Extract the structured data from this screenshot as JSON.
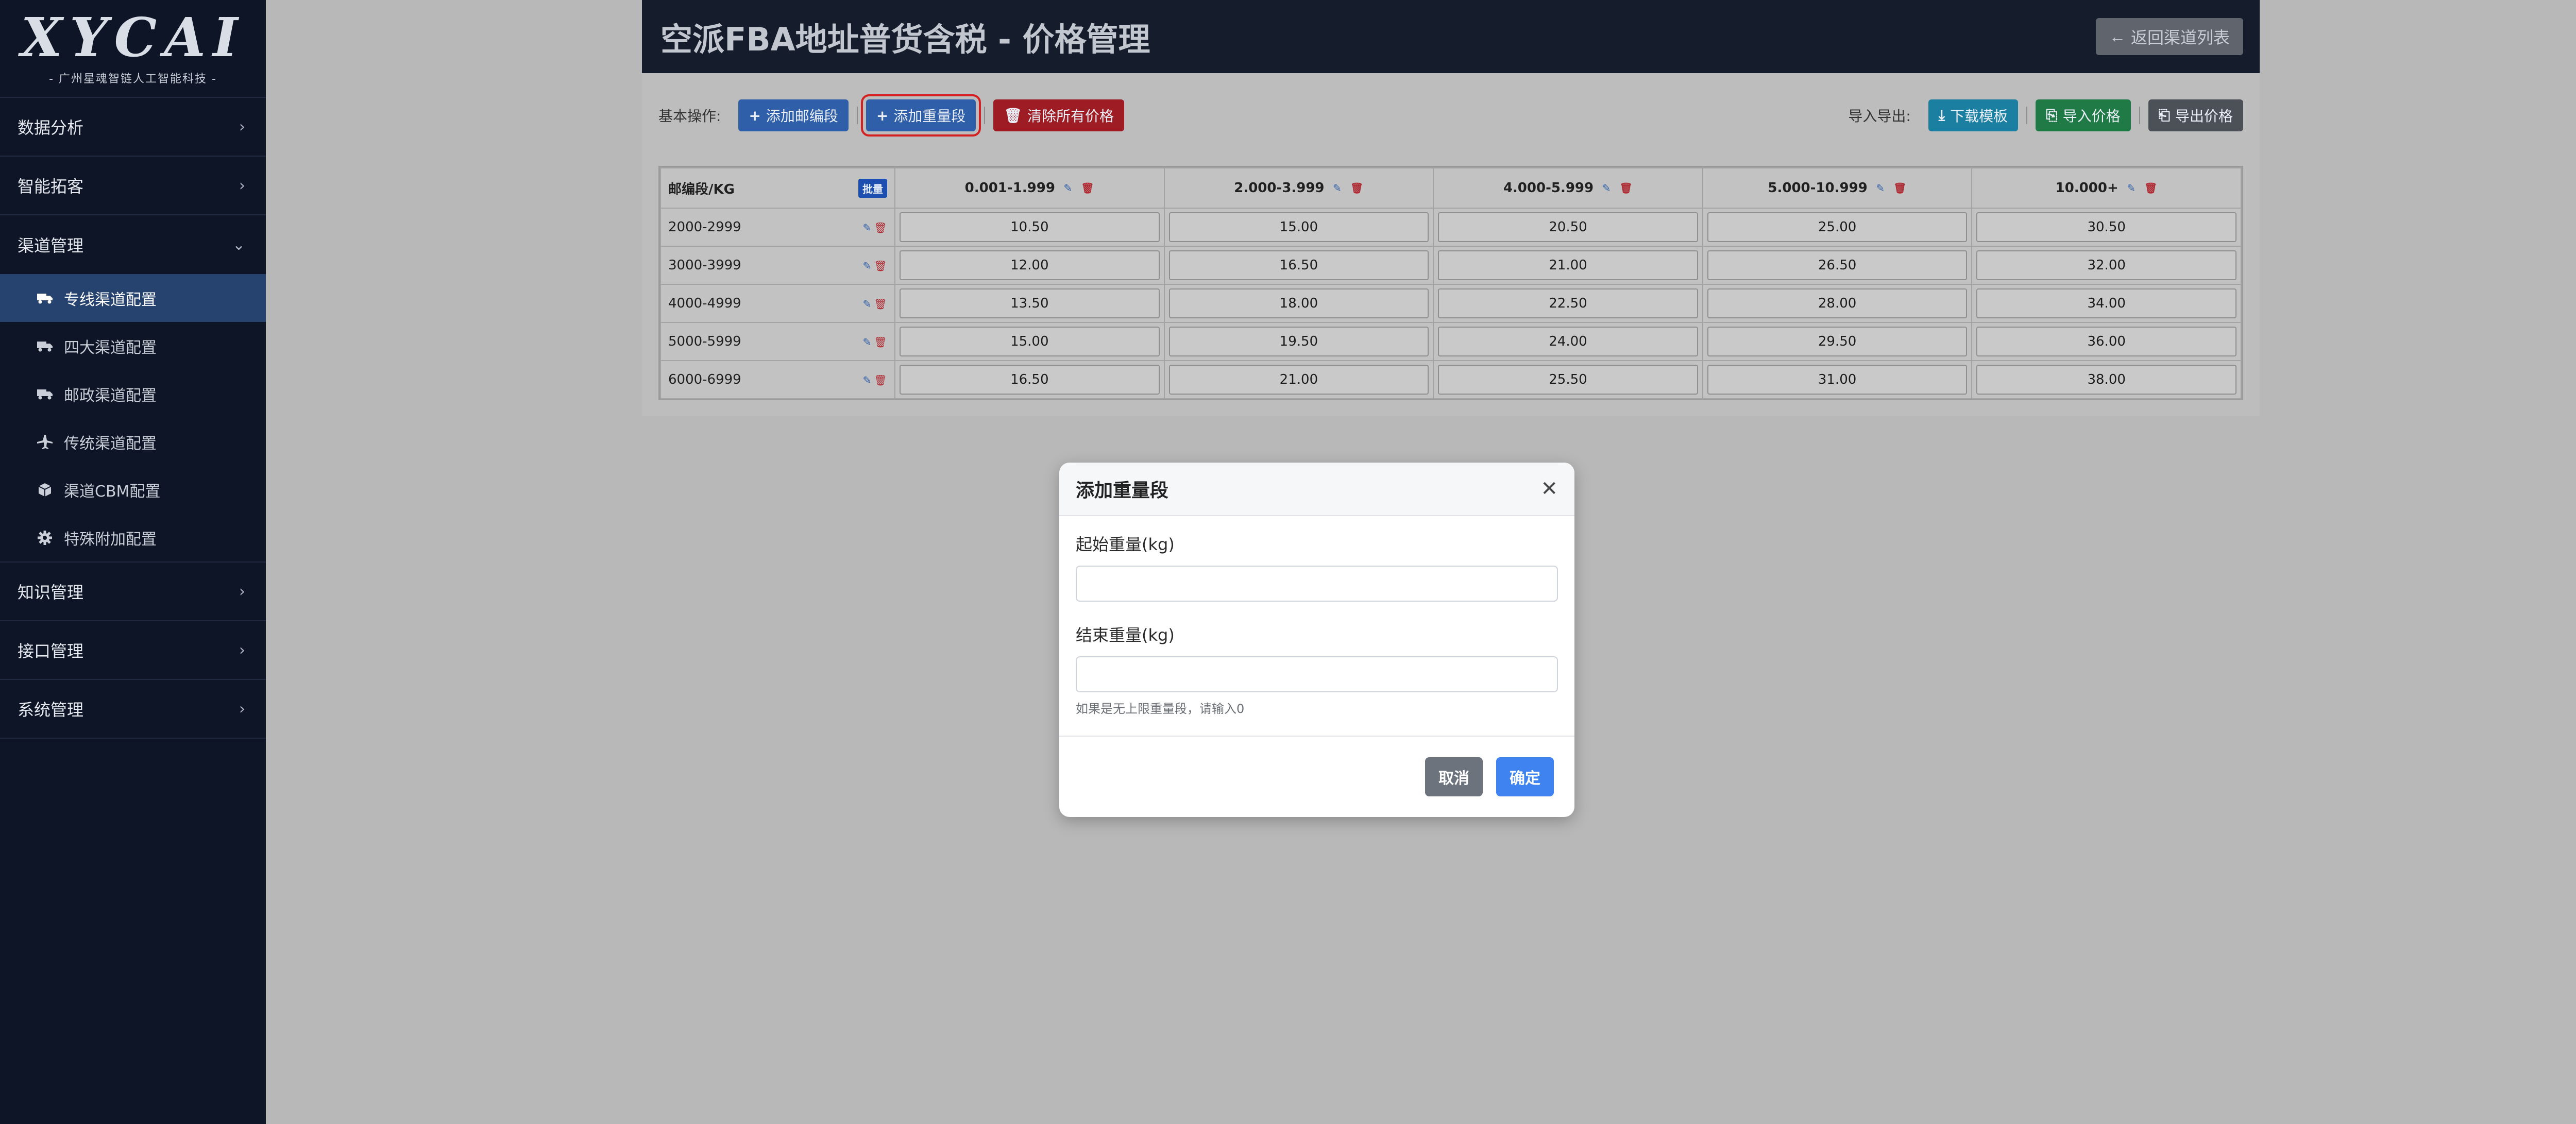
{
  "sidebar": {
    "logo_text": "XYCAI",
    "logo_sub": "- 广州星魂智链人工智能科技 -",
    "groups": [
      {
        "label": "数据分析"
      },
      {
        "label": "智能拓客"
      },
      {
        "label": "渠道管理"
      },
      {
        "label": "知识管理"
      },
      {
        "label": "接口管理"
      },
      {
        "label": "系统管理"
      }
    ],
    "channel_items": [
      {
        "label": "专线渠道配置",
        "icon": "truck-icon"
      },
      {
        "label": "四大渠道配置",
        "icon": "truck-icon"
      },
      {
        "label": "邮政渠道配置",
        "icon": "truck-icon"
      },
      {
        "label": "传统渠道配置",
        "icon": "plane-icon"
      },
      {
        "label": "渠道CBM配置",
        "icon": "box-icon"
      },
      {
        "label": "特殊附加配置",
        "icon": "gear-icon"
      }
    ]
  },
  "header": {
    "title": "空派FBA地址普货含税 - 价格管理",
    "back_label": "返回渠道列表"
  },
  "toolbar": {
    "basic_label": "基本操作:",
    "add_zip_label": "添加邮编段",
    "add_weight_label": "添加重量段",
    "clear_label": "清除所有价格",
    "io_label": "导入导出:",
    "download_label": "下载模板",
    "import_label": "导入价格",
    "export_label": "导出价格"
  },
  "table": {
    "corner_label": "邮编段/KG",
    "batch_label": "批量",
    "columns": [
      "0.001-1.999",
      "2.000-3.999",
      "4.000-5.999",
      "5.000-10.999",
      "10.000+"
    ],
    "rows": [
      {
        "zone": "2000-2999",
        "prices": [
          "10.50",
          "15.00",
          "20.50",
          "25.00",
          "30.50"
        ]
      },
      {
        "zone": "3000-3999",
        "prices": [
          "12.00",
          "16.50",
          "21.00",
          "26.50",
          "32.00"
        ]
      },
      {
        "zone": "4000-4999",
        "prices": [
          "13.50",
          "18.00",
          "22.50",
          "28.00",
          "34.00"
        ]
      },
      {
        "zone": "5000-5999",
        "prices": [
          "15.00",
          "19.50",
          "24.00",
          "29.50",
          "36.00"
        ]
      },
      {
        "zone": "6000-6999",
        "prices": [
          "16.50",
          "21.00",
          "25.50",
          "31.00",
          "38.00"
        ]
      }
    ]
  },
  "modal": {
    "title": "添加重量段",
    "start_label": "起始重量(kg)",
    "start_value": "",
    "start_placeholder": "",
    "end_label": "结束重量(kg)",
    "end_value": "",
    "end_placeholder": "",
    "help_text": "如果是无上限重量段，请输入0",
    "cancel_label": "取消",
    "ok_label": "确定"
  },
  "colors": {
    "sidebar_bg": "#0d1526",
    "active_item": "#26426f",
    "primary": "#3f83f0",
    "danger": "#9e1d25",
    "success": "#1f7a45"
  }
}
